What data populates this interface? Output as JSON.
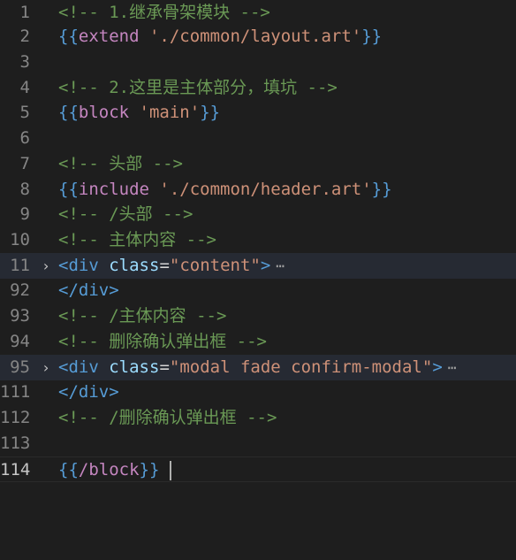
{
  "editor": {
    "lines": [
      {
        "num": "1",
        "comment": "<!-- 1.继承骨架模块 -->"
      },
      {
        "num": "2",
        "open": "{{",
        "kw": "extend",
        "space": " ",
        "str": "'./common/layout.art'",
        "close": "}}"
      },
      {
        "num": "3"
      },
      {
        "num": "4",
        "comment": "<!-- 2.这里是主体部分，填坑 -->"
      },
      {
        "num": "5",
        "open": "{{",
        "kw": "block",
        "space": " ",
        "str": "'main'",
        "close": "}}"
      },
      {
        "num": "6"
      },
      {
        "num": "7",
        "comment": "<!-- 头部 -->"
      },
      {
        "num": "8",
        "open": "{{",
        "kw": "include",
        "space": " ",
        "str": "'./common/header.art'",
        "close": "}}"
      },
      {
        "num": "9",
        "comment": "<!-- /头部 -->"
      },
      {
        "num": "10",
        "comment": "<!-- 主体内容 -->"
      },
      {
        "num": "11",
        "fold": "›",
        "lt": "<",
        "tag": "div",
        "space": " ",
        "attr": "class",
        "eq": "=",
        "val": "\"content\"",
        "gt": ">",
        "ellipsis": "⋯"
      },
      {
        "num": "92",
        "lt": "</",
        "tag": "div",
        "gt": ">"
      },
      {
        "num": "93",
        "comment": "<!-- /主体内容 -->"
      },
      {
        "num": "94",
        "comment": "<!-- 删除确认弹出框 -->"
      },
      {
        "num": "95",
        "fold": "›",
        "lt": "<",
        "tag": "div",
        "space": " ",
        "attr": "class",
        "eq": "=",
        "val": "\"modal fade confirm-modal\"",
        "gt": ">",
        "ellipsis": "⋯"
      },
      {
        "num": "111",
        "lt": "</",
        "tag": "div",
        "gt": ">"
      },
      {
        "num": "112",
        "comment": "<!-- /删除确认弹出框 -->"
      },
      {
        "num": "113"
      },
      {
        "num": "114",
        "open": "{{",
        "kw": "/block",
        "close": "}}"
      }
    ]
  }
}
